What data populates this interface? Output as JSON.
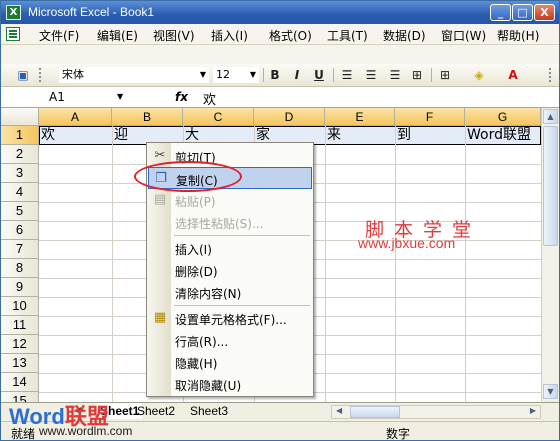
{
  "window": {
    "title": "Microsoft Excel - Book1",
    "minimize": "_",
    "maximize": "□",
    "close": "X"
  },
  "menu": {
    "items": [
      "文件(F)",
      "编辑(E)",
      "视图(V)",
      "插入(I)",
      "格式(O)",
      "工具(T)",
      "数据(D)",
      "窗口(W)",
      "帮助(H)"
    ],
    "doc_controls": [
      "_",
      "♂",
      "×"
    ]
  },
  "toolbar": {
    "font_name": "宋体",
    "font_size": "12",
    "bold": "B",
    "italic": "I",
    "underline": "U",
    "font_color_glyph": "A"
  },
  "formula_bar": {
    "name_box": "A1",
    "fx": "fx",
    "content": "欢"
  },
  "grid": {
    "columns": [
      "A",
      "B",
      "C",
      "D",
      "E",
      "F",
      "G"
    ],
    "rows": [
      "1",
      "2",
      "3",
      "4",
      "5",
      "6",
      "7",
      "8",
      "9",
      "10",
      "11",
      "12",
      "13",
      "14",
      "15"
    ],
    "row1": [
      "欢",
      "迎",
      "大",
      "家",
      "来",
      "到",
      "Word联盟"
    ]
  },
  "context_menu": {
    "items": [
      {
        "label": "剪切(T)",
        "icon": "scissors-icon",
        "enabled": true
      },
      {
        "label": "复制(C)",
        "icon": "copy-icon",
        "enabled": true,
        "highlighted": true
      },
      {
        "label": "粘贴(P)",
        "icon": "paste-icon",
        "enabled": false
      },
      {
        "label": "选择性粘贴(S)...",
        "enabled": false
      },
      {
        "label": "插入(I)",
        "enabled": true
      },
      {
        "label": "删除(D)",
        "enabled": true
      },
      {
        "label": "清除内容(N)",
        "enabled": true
      },
      {
        "label": "设置单元格格式(F)...",
        "icon": "format-cells-icon",
        "enabled": true
      },
      {
        "label": "行高(R)...",
        "enabled": true
      },
      {
        "label": "隐藏(H)",
        "enabled": true
      },
      {
        "label": "取消隐藏(U)",
        "enabled": true
      }
    ]
  },
  "sheets": {
    "tabs": [
      "Sheet1",
      "Sheet2",
      "Sheet3"
    ],
    "active": "Sheet1"
  },
  "status": {
    "left": "就绪",
    "mode": "数字"
  },
  "watermarks": {
    "site_cn": "脚本学堂",
    "site_url": "www.jbxue.com",
    "logo_a": "Word",
    "logo_b": "联盟",
    "logo_url": "www.wordlm.com"
  },
  "colors": {
    "title_bar": "#2a5db0",
    "highlight": "#c1d2ee",
    "row_select": "#e4ecf7",
    "annotation": "#e0202a"
  }
}
